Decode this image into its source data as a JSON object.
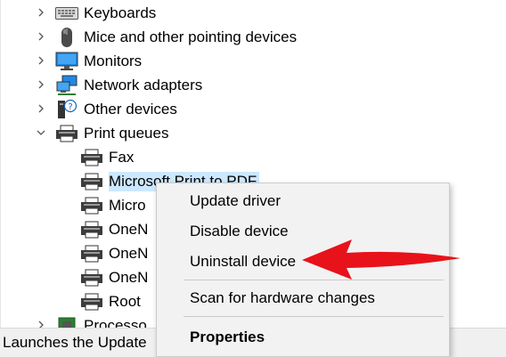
{
  "tree": {
    "items": [
      {
        "label": "Keyboards",
        "icon": "keyboard-icon",
        "expanded": false
      },
      {
        "label": "Mice and other pointing devices",
        "icon": "mouse-icon",
        "expanded": false
      },
      {
        "label": "Monitors",
        "icon": "monitor-icon",
        "expanded": false
      },
      {
        "label": "Network adapters",
        "icon": "network-adapter-icon",
        "expanded": false
      },
      {
        "label": "Other devices",
        "icon": "unknown-device-icon",
        "expanded": false
      },
      {
        "label": "Print queues",
        "icon": "printer-icon",
        "expanded": true
      },
      {
        "label": "Fax",
        "icon": "printer-icon"
      },
      {
        "label": "Microsoft Print to PDF",
        "icon": "printer-icon",
        "selected": true
      },
      {
        "label": "Micro",
        "icon": "printer-icon"
      },
      {
        "label": "OneN",
        "icon": "printer-icon"
      },
      {
        "label": "OneN",
        "icon": "printer-icon"
      },
      {
        "label": "OneN",
        "icon": "printer-icon"
      },
      {
        "label": "Root",
        "icon": "printer-icon"
      },
      {
        "label": "Processo",
        "icon": "processor-icon",
        "expanded": false
      }
    ]
  },
  "context_menu": {
    "items": [
      {
        "label": "Update driver",
        "bold": false
      },
      {
        "label": "Disable device",
        "bold": false
      },
      {
        "label": "Uninstall device",
        "bold": false
      },
      {
        "label": "Scan for hardware changes",
        "bold": false
      },
      {
        "label": "Properties",
        "bold": true
      }
    ]
  },
  "status_bar": {
    "text": "Launches the Update"
  },
  "colors": {
    "selection": "#cce8ff",
    "arrow": "#e8121a",
    "menu_bg": "#f2f2f2"
  }
}
